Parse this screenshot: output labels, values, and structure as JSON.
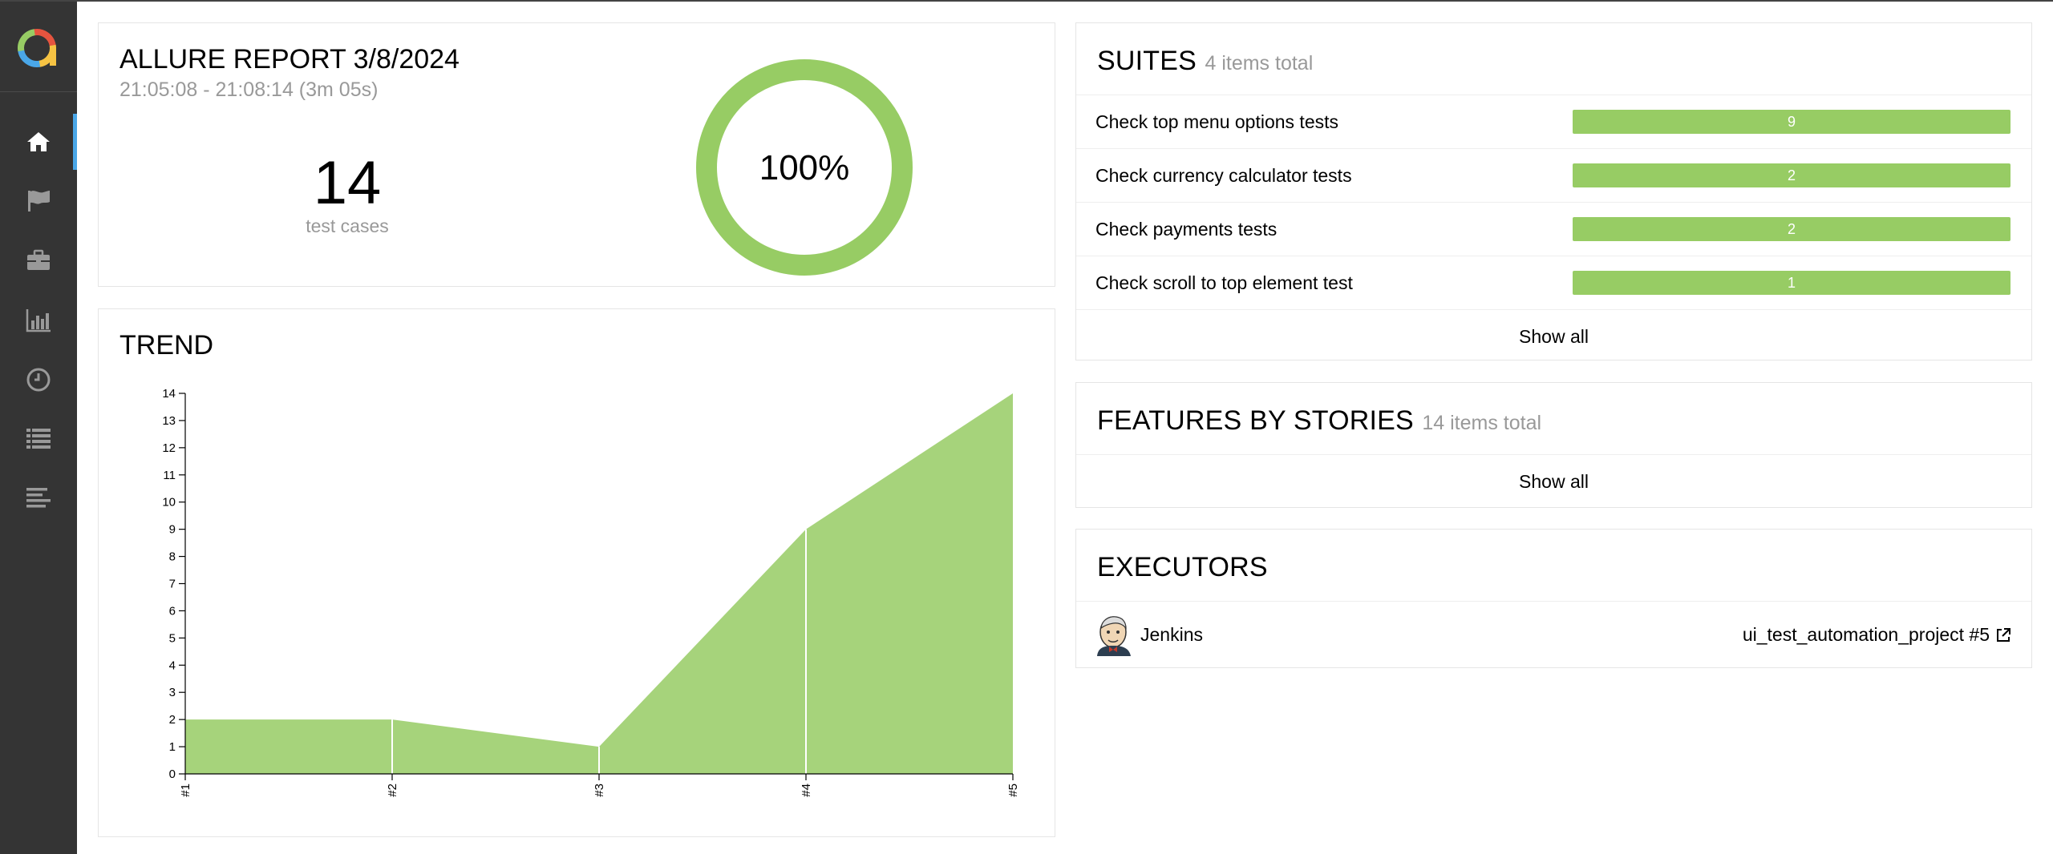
{
  "sidebar": {
    "items": [
      {
        "icon": "home-icon",
        "active": true
      },
      {
        "icon": "flag-icon",
        "active": false
      },
      {
        "icon": "briefcase-icon",
        "active": false
      },
      {
        "icon": "bar-chart-icon",
        "active": false
      },
      {
        "icon": "clock-icon",
        "active": false
      },
      {
        "icon": "list-icon",
        "active": false
      },
      {
        "icon": "timeline-icon",
        "active": false
      }
    ]
  },
  "summary": {
    "title": "ALLURE REPORT 3/8/2024",
    "time": "21:05:08 - 21:08:14 (3m 05s)",
    "count": "14",
    "count_label": "test cases",
    "percent": "100%",
    "passed_fraction": 1.0
  },
  "suites": {
    "title": "SUITES",
    "subtitle": "4 items total",
    "items": [
      {
        "name": "Check top menu options tests",
        "count": "9"
      },
      {
        "name": "Check currency calculator tests",
        "count": "2"
      },
      {
        "name": "Check payments tests",
        "count": "2"
      },
      {
        "name": "Check scroll to top element test",
        "count": "1"
      }
    ],
    "show_all": "Show all"
  },
  "features": {
    "title": "FEATURES BY STORIES",
    "subtitle": "14 items total",
    "show_all": "Show all"
  },
  "executors": {
    "title": "EXECUTORS",
    "name": "Jenkins",
    "build": "ui_test_automation_project #5"
  },
  "trend": {
    "title": "TREND"
  },
  "colors": {
    "passed": "#97cc64",
    "trend_fill": "#a6d37b",
    "sidebar": "#343434",
    "active_marker": "#4aa7e8"
  },
  "chart_data": {
    "type": "area",
    "title": "TREND",
    "x": [
      "#1",
      "#2",
      "#3",
      "#4",
      "#5"
    ],
    "series": [
      {
        "values": [
          2,
          2,
          1,
          9,
          14
        ]
      }
    ],
    "ylim": [
      0,
      14
    ],
    "yticks": [
      0,
      1,
      2,
      3,
      4,
      5,
      6,
      7,
      8,
      9,
      10,
      11,
      12,
      13,
      14
    ],
    "grid": false
  }
}
